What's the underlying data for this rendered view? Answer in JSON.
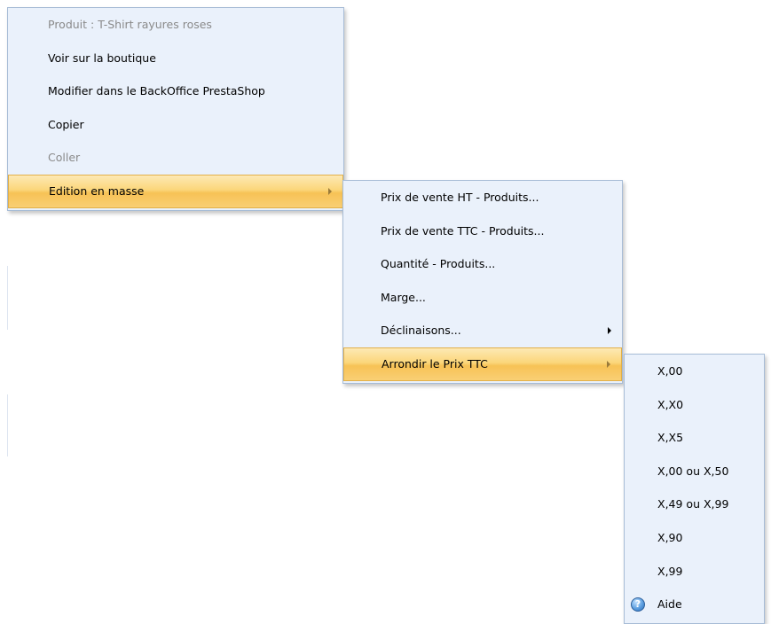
{
  "menu1": {
    "items": [
      {
        "label": "Produit : T-Shirt rayures roses"
      },
      {
        "label": "Voir sur la boutique"
      },
      {
        "label": "Modifier dans le BackOffice PrestaShop"
      },
      {
        "label": "Copier"
      },
      {
        "label": "Coller"
      },
      {
        "label": "Edition en masse"
      }
    ]
  },
  "menu2": {
    "items": [
      {
        "label": "Prix de vente HT - Produits..."
      },
      {
        "label": "Prix de vente TTC - Produits..."
      },
      {
        "label": "Quantité - Produits..."
      },
      {
        "label": "Marge..."
      },
      {
        "label": "Déclinaisons..."
      },
      {
        "label": "Arrondir le Prix TTC"
      }
    ]
  },
  "menu3": {
    "items": [
      {
        "label": "X,00"
      },
      {
        "label": "X,X0"
      },
      {
        "label": "X,X5"
      },
      {
        "label": "X,00 ou X,50"
      },
      {
        "label": "X,49 ou X,99"
      },
      {
        "label": "X,90"
      },
      {
        "label": "X,99"
      },
      {
        "label": "Aide",
        "icon": "help-icon"
      }
    ]
  },
  "colors": {
    "menu_background": "#eaf1fb",
    "menu_border": "#a7bcd6",
    "highlight": "#f9cf74",
    "disabled_text": "#8a8a8a"
  }
}
